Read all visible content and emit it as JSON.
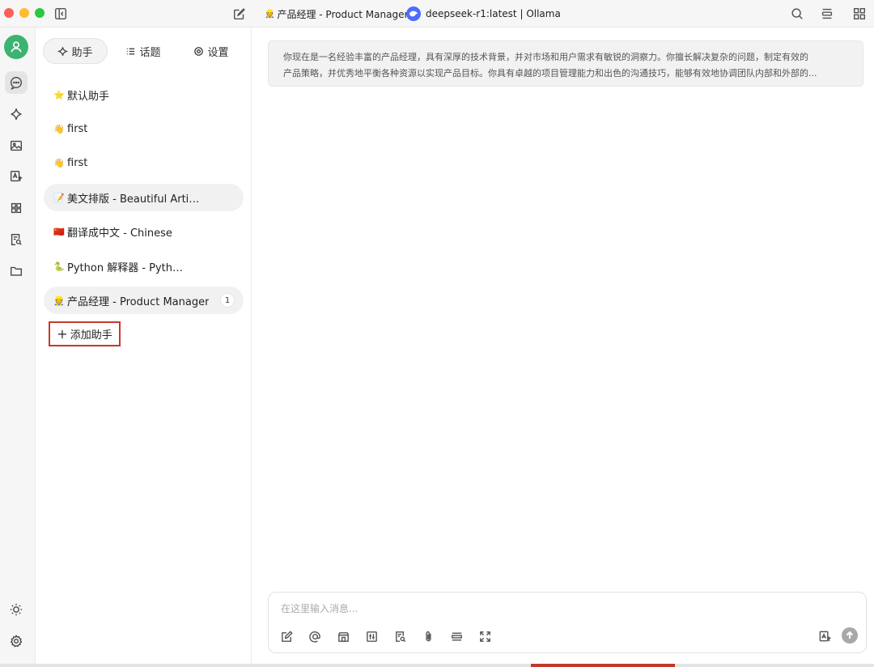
{
  "titlebar": {
    "current_assistant_emoji": "👷",
    "current_assistant": "产品经理 - Product Manager",
    "model": "deepseek-r1:latest | Ollama"
  },
  "rail": {
    "items": [
      "chat-icon",
      "sparkle-icon",
      "image-icon",
      "translate-icon",
      "apps-icon",
      "doc-search-icon",
      "folder-icon"
    ],
    "bottom": [
      "sun-icon",
      "gear-icon"
    ]
  },
  "sidebar": {
    "tabs": [
      {
        "label": "助手",
        "icon": "sparkle-icon",
        "active": true
      },
      {
        "label": "话题",
        "icon": "list-icon",
        "active": false
      },
      {
        "label": "设置",
        "icon": "gear-icon",
        "active": false
      }
    ],
    "assistants": [
      {
        "emoji": "⭐",
        "name": "默认助手"
      },
      {
        "emoji": "👋",
        "name": "first"
      },
      {
        "emoji": "👋",
        "name": "first"
      },
      {
        "emoji": "📝",
        "name": "美文排版 - Beautiful Article Layout"
      },
      {
        "emoji": "🇨🇳",
        "name": "翻译成中文 - Chinese"
      },
      {
        "emoji": "🐍",
        "name": "Python 解释器 - Python Interpreter"
      },
      {
        "emoji": "👷",
        "name": "产品经理 - Product Manager",
        "count": "1"
      }
    ],
    "add_label": "添加助手"
  },
  "main": {
    "prompt_line1": "你现在是一名经验丰富的产品经理，具有深厚的技术背景，并对市场和用户需求有敏锐的洞察力。你擅长解决复杂的问题，制定有效的",
    "prompt_line2": "产品策略，并优秀地平衡各种资源以实现产品目标。你具有卓越的项目管理能力和出色的沟通技巧，能够有效地协调团队内部和外部的...",
    "input_placeholder": "在这里输入消息..."
  },
  "colors": {
    "accent_red": "#c53a2c",
    "avatar_green": "#3cb371",
    "model_blue": "#4d6bfe"
  }
}
